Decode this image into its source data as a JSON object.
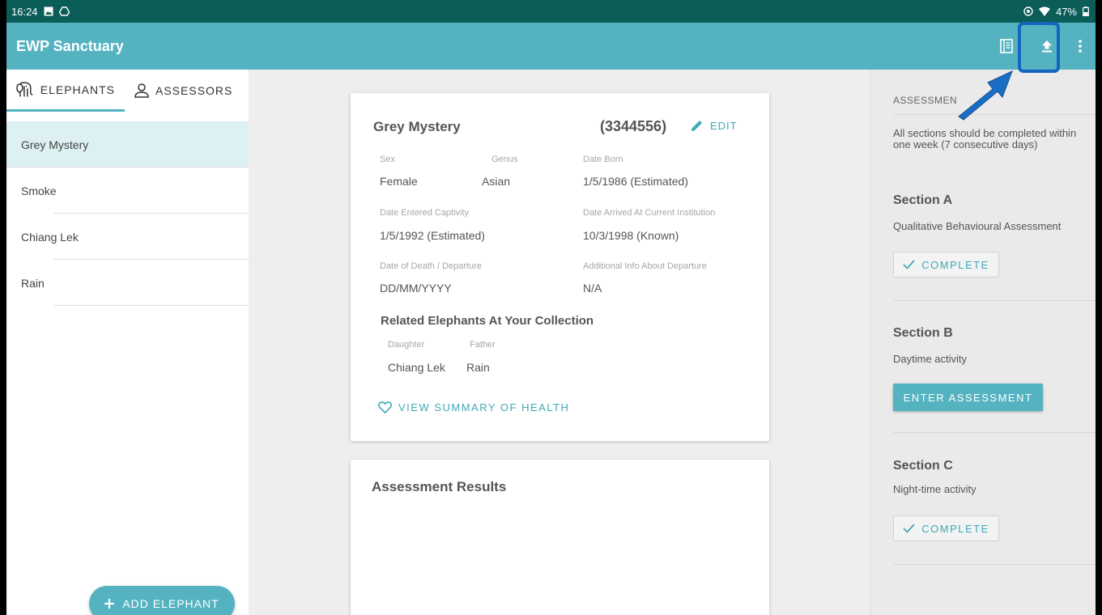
{
  "status_bar": {
    "time": "16:24",
    "battery": "47%"
  },
  "app_bar": {
    "title": "EWP Sanctuary"
  },
  "tabs": [
    {
      "label": "ELEPHANTS",
      "icon": "elephant-icon",
      "active": true
    },
    {
      "label": "ASSESSORS",
      "icon": "person-icon",
      "active": false
    }
  ],
  "elephants": [
    "Grey Mystery",
    "Smoke",
    "Chiang Lek",
    "Rain"
  ],
  "add_button": {
    "label": "ADD ELEPHANT"
  },
  "detail": {
    "name": "Grey Mystery",
    "id": "(3344556)",
    "edit_label": "EDIT",
    "sex_label": "Sex",
    "sex": "Female",
    "genus_label": "Genus",
    "genus": "Asian",
    "born_label": "Date Born",
    "born": "1/5/1986 (Estimated)",
    "captivity_label": "Date Entered Captivity",
    "captivity": "1/5/1992 (Estimated)",
    "arrived_label": "Date Arrived At Current Institution",
    "arrived": "10/3/1998 (Known)",
    "death_label": "Date of Death / Departure",
    "death": "DD/MM/YYYY",
    "departure_info_label": "Additional Info About Departure",
    "departure_info": "N/A",
    "related_title": "Related Elephants At Your Collection",
    "related": [
      {
        "relation": "Daughter",
        "name": "Chiang Lek"
      },
      {
        "relation": "Father",
        "name": "Rain"
      }
    ],
    "health_link": "VIEW SUMMARY OF HEALTH"
  },
  "results": {
    "title": "Assessment Results"
  },
  "assessment_panel": {
    "title": "ASSESSMEN",
    "description": "All sections should be completed within one week (7 consecutive days)",
    "sections": [
      {
        "title": "Section A",
        "desc": "Qualitative Behavioural Assessment",
        "button": "COMPLETE",
        "state": "complete"
      },
      {
        "title": "Section B",
        "desc": "Daytime activity",
        "button": "ENTER ASSESSMENT",
        "state": "pending"
      },
      {
        "title": "Section C",
        "desc": "Night-time activity",
        "button": "COMPLETE",
        "state": "complete"
      }
    ]
  },
  "colors": {
    "status_bar": "#0b5d58",
    "app_bar": "#55b3c1",
    "accent": "#3fa9b8",
    "highlight": "#1565c0"
  }
}
